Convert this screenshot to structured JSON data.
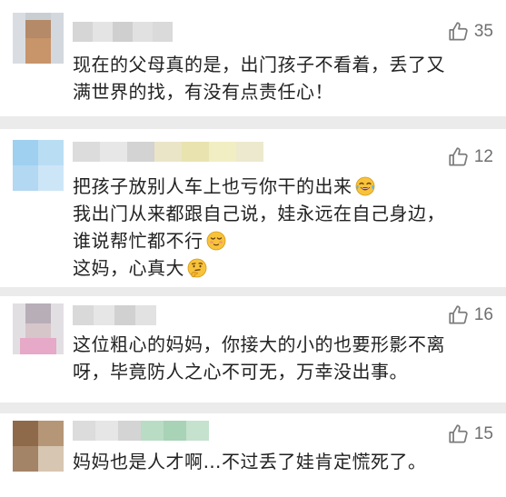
{
  "comments": [
    {
      "likes": "35",
      "lines": [
        "现在的父母真的是，出门孩子不看着，丢了又",
        "满世界的找，有没有点责任心！"
      ]
    },
    {
      "likes": "12",
      "lines": [
        "把孩子放别人车上也亏你干的出来",
        "我出门从来都跟自己说，娃永远在自己身边，",
        "谁说帮忙都不行",
        "这妈，心真大"
      ],
      "emojis": [
        "laughing-tears-emoji",
        "relieved-emoji",
        "thinking-emoji"
      ]
    },
    {
      "likes": "16",
      "lines": [
        "这位粗心的妈妈，你接大的小的也要形影不离",
        "呀，毕竟防人之心不可无，万幸没出事。"
      ]
    },
    {
      "likes": "15",
      "lines": [
        "妈妈也是人才啊…不过丢了娃肯定慌死了。"
      ]
    }
  ],
  "colors": {
    "separator": "#ebebeb",
    "text": "#222222",
    "like_icon": "#7b7b7b"
  }
}
